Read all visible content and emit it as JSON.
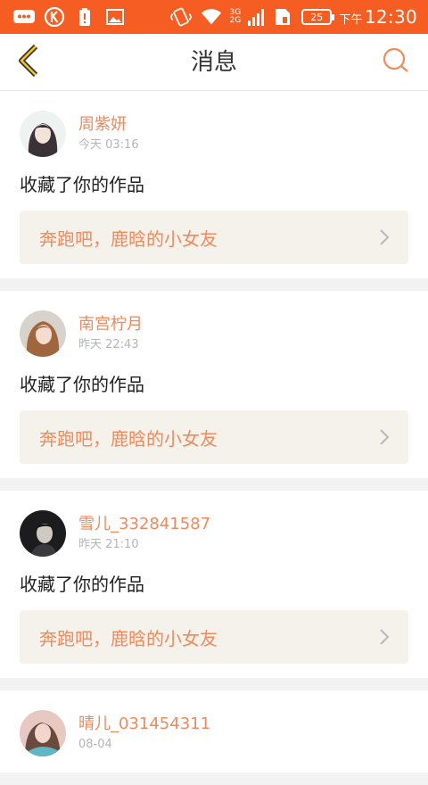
{
  "status_bar": {
    "network_top": "3G",
    "network_bottom": "2G",
    "battery": "25",
    "ampm": "下午",
    "time": "12:30"
  },
  "header": {
    "title": "消息",
    "back_icon": "back-chevron-icon",
    "search_icon": "search-icon"
  },
  "colors": {
    "status_bar": "#f65d22",
    "accent": "#f08a5d",
    "work_box_bg": "#f4f2ea"
  },
  "messages": [
    {
      "username": "周紫妍",
      "time": "今天 03:16",
      "action": "收藏了你的作品",
      "work_title": "奔跑吧，鹿晗的小女友"
    },
    {
      "username": "南宫柠月",
      "time": "昨天 22:43",
      "action": "收藏了你的作品",
      "work_title": "奔跑吧，鹿晗的小女友"
    },
    {
      "username": "雪儿_332841587",
      "time": "昨天 21:10",
      "action": "收藏了你的作品",
      "work_title": "奔跑吧，鹿晗的小女友"
    },
    {
      "username": "晴儿_031454311",
      "time": "08-04",
      "action": "",
      "work_title": ""
    }
  ]
}
